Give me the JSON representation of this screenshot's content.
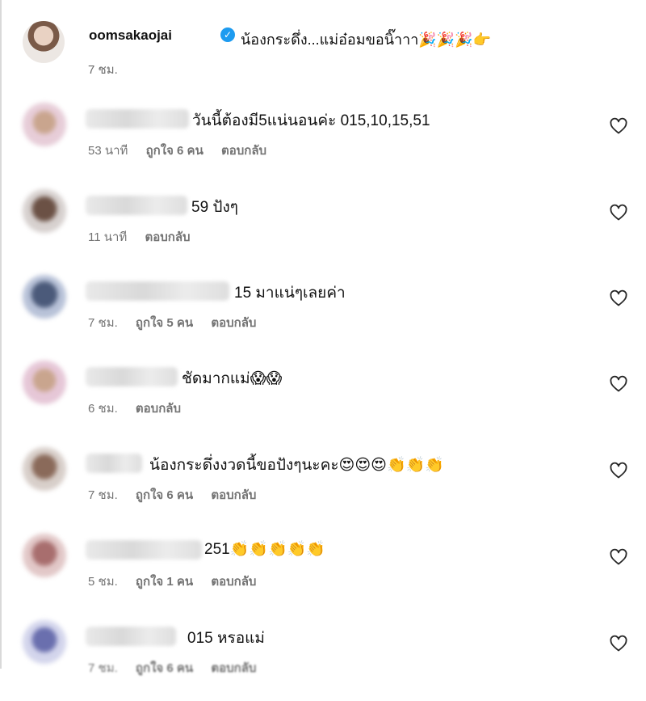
{
  "post": {
    "username": "oomsakaojai",
    "caption": "น้องกระดึ่ง...แม่อ๋อมขอนิ๊าาา🎉🎉🎉👉",
    "time": "7 ชม."
  },
  "comments": [
    {
      "text": "วันนี้ต้องมี5แน่นอนค่ะ 015,10,15,51",
      "time": "53 นาที",
      "likes": "ถูกใจ 6 คน",
      "reply": "ตอบกลับ"
    },
    {
      "text": "59 ปังๆ",
      "time": "11 นาที",
      "likes": "",
      "reply": "ตอบกลับ"
    },
    {
      "text": "15 มาแน่ๆเลยค่า",
      "time": "7 ชม.",
      "likes": "ถูกใจ 5 คน",
      "reply": "ตอบกลับ"
    },
    {
      "text": "ชัดมากแม่😱😱",
      "time": "6 ชม.",
      "likes": "",
      "reply": "ตอบกลับ"
    },
    {
      "text": "น้องกระดึ่งงวดนี้ขอปังๆนะคะ😍😍😍👏👏👏",
      "time": "7 ชม.",
      "likes": "ถูกใจ 6 คน",
      "reply": "ตอบกลับ"
    },
    {
      "text": "251👏👏👏👏👏",
      "time": "5 ชม.",
      "likes": "ถูกใจ 1 คน",
      "reply": "ตอบกลับ"
    },
    {
      "text": "015 หรอแม่",
      "time": "7 ชม.",
      "likes": "ถูกใจ 6 คน",
      "reply": "ตอบกลับ"
    }
  ],
  "icons": {
    "like": "heart-icon",
    "verified": "verified-badge-icon"
  },
  "colors": {
    "verified": "#1d9bf0",
    "meta_text": "#737373"
  }
}
